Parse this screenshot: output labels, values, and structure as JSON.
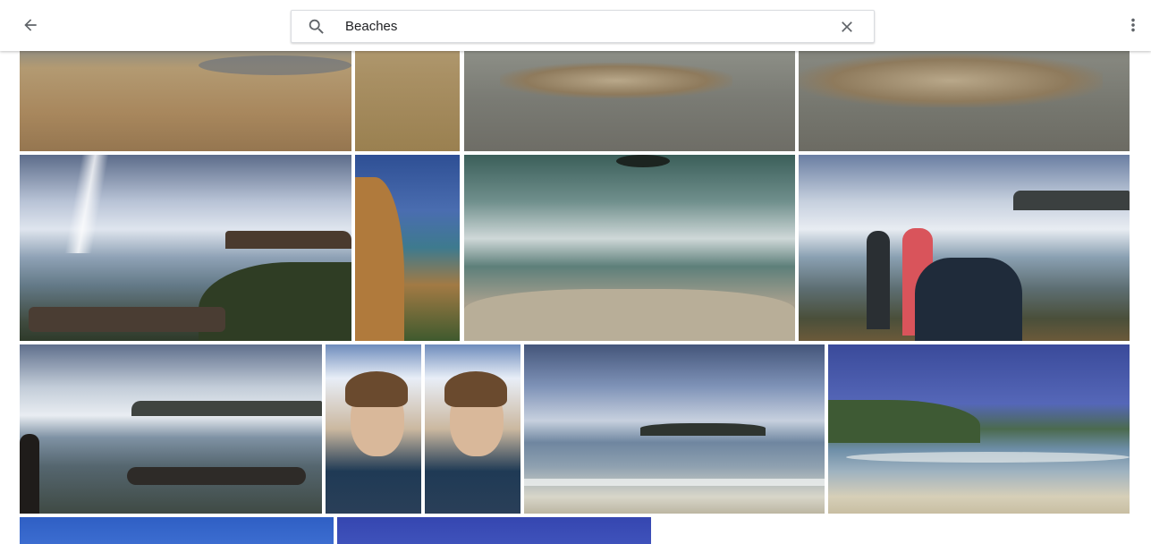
{
  "header": {
    "back_icon": "arrow-back-icon",
    "search_icon": "search-icon",
    "clear_icon": "close-icon",
    "more_icon": "more-vert-icon"
  },
  "search": {
    "query": "Beaches"
  },
  "colors": {
    "header_bg": "#ffffff",
    "icon": "#5f6368",
    "text": "#202124"
  },
  "photos": [
    {
      "id": "photo-1",
      "subject": "sandy-shore"
    },
    {
      "id": "photo-2",
      "subject": "sand-ground"
    },
    {
      "id": "photo-3",
      "subject": "driftwood-water"
    },
    {
      "id": "photo-4",
      "subject": "driftwood-water"
    },
    {
      "id": "photo-5",
      "subject": "coast-sun"
    },
    {
      "id": "photo-6",
      "subject": "cliff-sea"
    },
    {
      "id": "photo-7",
      "subject": "waves-rocks"
    },
    {
      "id": "photo-8",
      "subject": "people-coast"
    },
    {
      "id": "photo-9",
      "subject": "coast-sun"
    },
    {
      "id": "photo-10",
      "subject": "selfie"
    },
    {
      "id": "photo-11",
      "subject": "selfie"
    },
    {
      "id": "photo-12",
      "subject": "island-beach"
    },
    {
      "id": "photo-13",
      "subject": "beach-shore"
    },
    {
      "id": "photo-14",
      "subject": "blue-sky"
    },
    {
      "id": "photo-15",
      "subject": "blue-sky"
    }
  ]
}
